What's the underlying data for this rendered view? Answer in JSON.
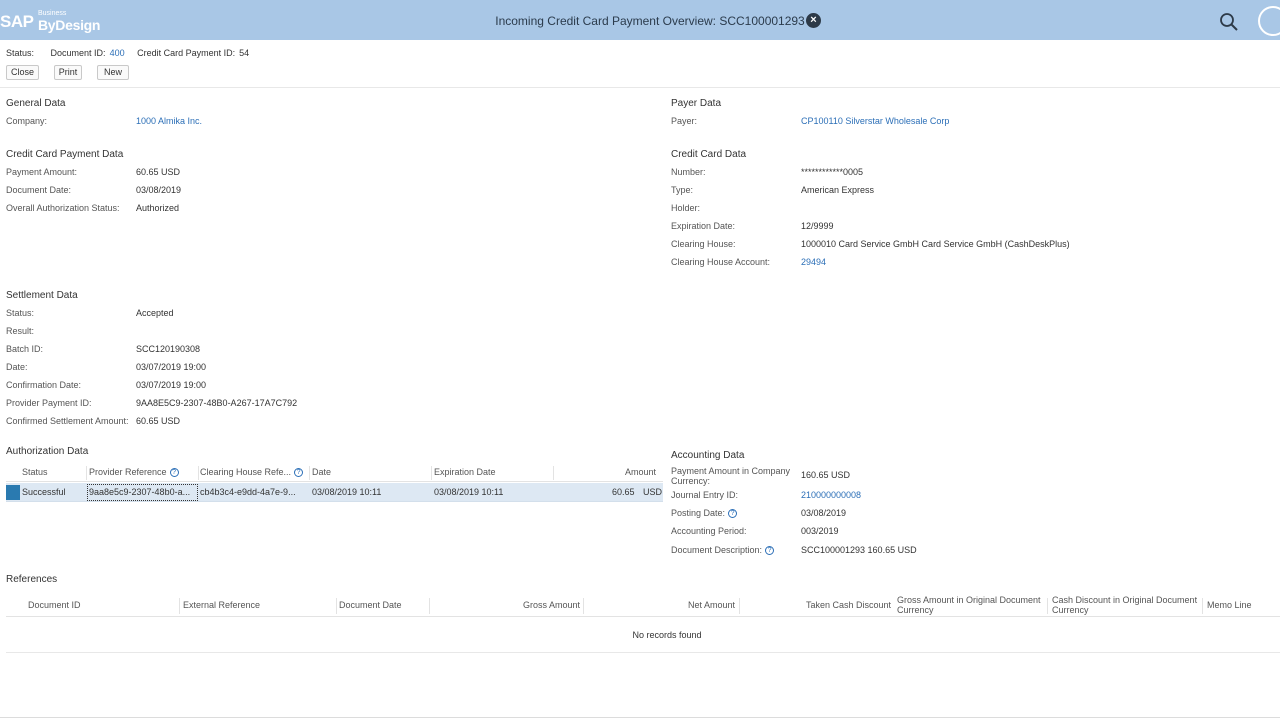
{
  "header": {
    "logo_sap": "SAP",
    "logo_business": "Business",
    "logo_bydesign": "ByDesign",
    "title": "Incoming Credit Card Payment Overview: SCC100001293",
    "close_icon": "×",
    "colors": {
      "bar": "#a9c7e6",
      "link": "#2c6fb7"
    }
  },
  "statusbar": {
    "status_label": "Status:",
    "docid_label": "Document ID:",
    "docid_value": "400",
    "ccpid_label": "Credit Card Payment ID:",
    "ccpid_value": "54"
  },
  "toolbar": {
    "close": "Close",
    "print": "Print",
    "new": "New"
  },
  "general": {
    "title": "General Data",
    "company_label": "Company:",
    "company_value": "1000 Almika Inc."
  },
  "payer": {
    "title": "Payer Data",
    "payer_label": "Payer:",
    "payer_value": "CP100110 Silverstar Wholesale Corp"
  },
  "ccpayment": {
    "title": "Credit Card Payment Data",
    "amount_label": "Payment Amount:",
    "amount_value": "60.65 USD",
    "date_label": "Document Date:",
    "date_value": "03/08/2019",
    "auth_label": "Overall Authorization Status:",
    "auth_value": "Authorized"
  },
  "card": {
    "title": "Credit Card Data",
    "number_label": "Number:",
    "number_value": "************0005",
    "type_label": "Type:",
    "type_value": "American Express",
    "holder_label": "Holder:",
    "exp_label": "Expiration Date:",
    "exp_value": "12/9999",
    "ch_label": "Clearing House:",
    "ch_value": "1000010 Card Service GmbH Card Service GmbH (CashDeskPlus)",
    "cha_label": "Clearing House Account:",
    "cha_value": "29494"
  },
  "settlement": {
    "title": "Settlement Data",
    "status_label": "Status:",
    "status_value": "Accepted",
    "result_label": "Result:",
    "batch_label": "Batch ID:",
    "batch_value": "SCC120190308",
    "date_label": "Date:",
    "date_value": "03/07/2019 19:00",
    "conf_label": "Confirmation Date:",
    "conf_value": "03/07/2019 19:00",
    "ppid_label": "Provider Payment ID:",
    "ppid_value": "9AA8E5C9-2307-48B0-A267-17A7C792",
    "csa_label": "Confirmed Settlement Amount:",
    "csa_value": "60.65 USD"
  },
  "authorization": {
    "title": "Authorization Data",
    "columns": [
      "Status",
      "Provider Reference",
      "Clearing House Refe...",
      "Date",
      "Expiration Date",
      "Amount"
    ],
    "rows": [
      {
        "status": "Successful",
        "provider_ref": "9aa8e5c9-2307-48b0-a...",
        "clearing_ref": "cb4b3c4-e9dd-4a7e-9...",
        "date": "03/08/2019 10:11",
        "expiration": "03/08/2019 10:11",
        "amount": "60.65",
        "currency": "USD"
      }
    ]
  },
  "accounting": {
    "title": "Accounting Data",
    "pacc_label": "Payment Amount in Company Currency:",
    "pacc_value": "160.65 USD",
    "je_label": "Journal Entry ID:",
    "je_value": "210000000008",
    "pd_label": "Posting Date:",
    "pd_value": "03/08/2019",
    "ap_label": "Accounting Period:",
    "ap_value": "003/2019",
    "dd_label": "Document Description:",
    "dd_value": "SCC100001293 160.65 USD"
  },
  "references": {
    "title": "References",
    "columns": [
      "Document ID",
      "External Reference",
      "Document Date",
      "Gross Amount",
      "Net Amount",
      "Taken Cash Discount",
      "Gross Amount in Original Document Currency",
      "Cash Discount in Original Document Currency",
      "Memo Line"
    ],
    "empty_text": "No records found"
  },
  "help_glyph": "?"
}
